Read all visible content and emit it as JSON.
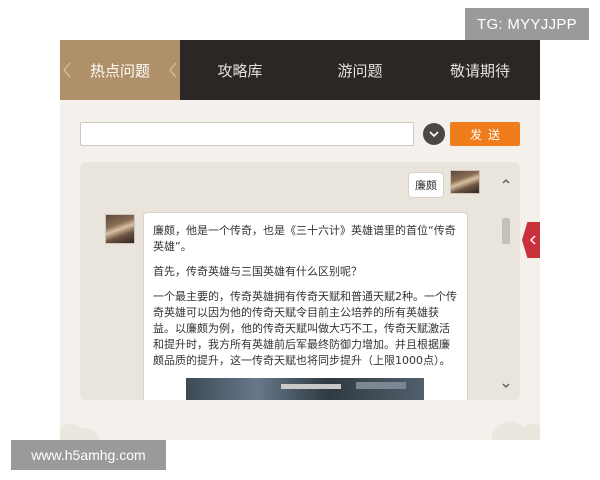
{
  "overlay": {
    "tg_label": "TG: MYYJJPP",
    "site_watermark": "www.h5amhg.com"
  },
  "tabs": [
    {
      "label": "热点问题",
      "active": true
    },
    {
      "label": "攻略库",
      "active": false
    },
    {
      "label": "游问题",
      "active": false
    },
    {
      "label": "敬请期待",
      "active": false
    }
  ],
  "search": {
    "value": "",
    "placeholder": "",
    "send_label": "发送"
  },
  "chat": {
    "user_message": "廉颇",
    "bot_paragraphs": [
      "廉颇，他是一个传奇，也是《三十六计》英雄谱里的首位“传奇英雄”。",
      "首先，传奇英雄与三国英雄有什么区别呢？",
      "一个最主要的，传奇英雄拥有传奇天赋和普通天赋2种。一个传奇英雄可以因为他的传奇天赋令目前主公培养的所有英雄获益。以廉颇为例，他的传奇天赋叫做大巧不工，传奇天赋激活和提升时，我方所有英雄前后军最终防御力增加。并且根据廉颇品质的提升，这一传奇天赋也将同步提升（上限1000点）。"
    ]
  },
  "colors": {
    "tab_bar": "#2a2724",
    "tab_active": "#b09068",
    "send_button": "#ef7d1c",
    "side_tab": "#c8323a",
    "chat_bg": "#e9e4dc"
  },
  "icons": {
    "dropdown": "chevron-down-icon",
    "scroll_up": "caret-up-icon",
    "scroll_down": "caret-down-icon",
    "side_tab": "chevron-left-icon"
  }
}
